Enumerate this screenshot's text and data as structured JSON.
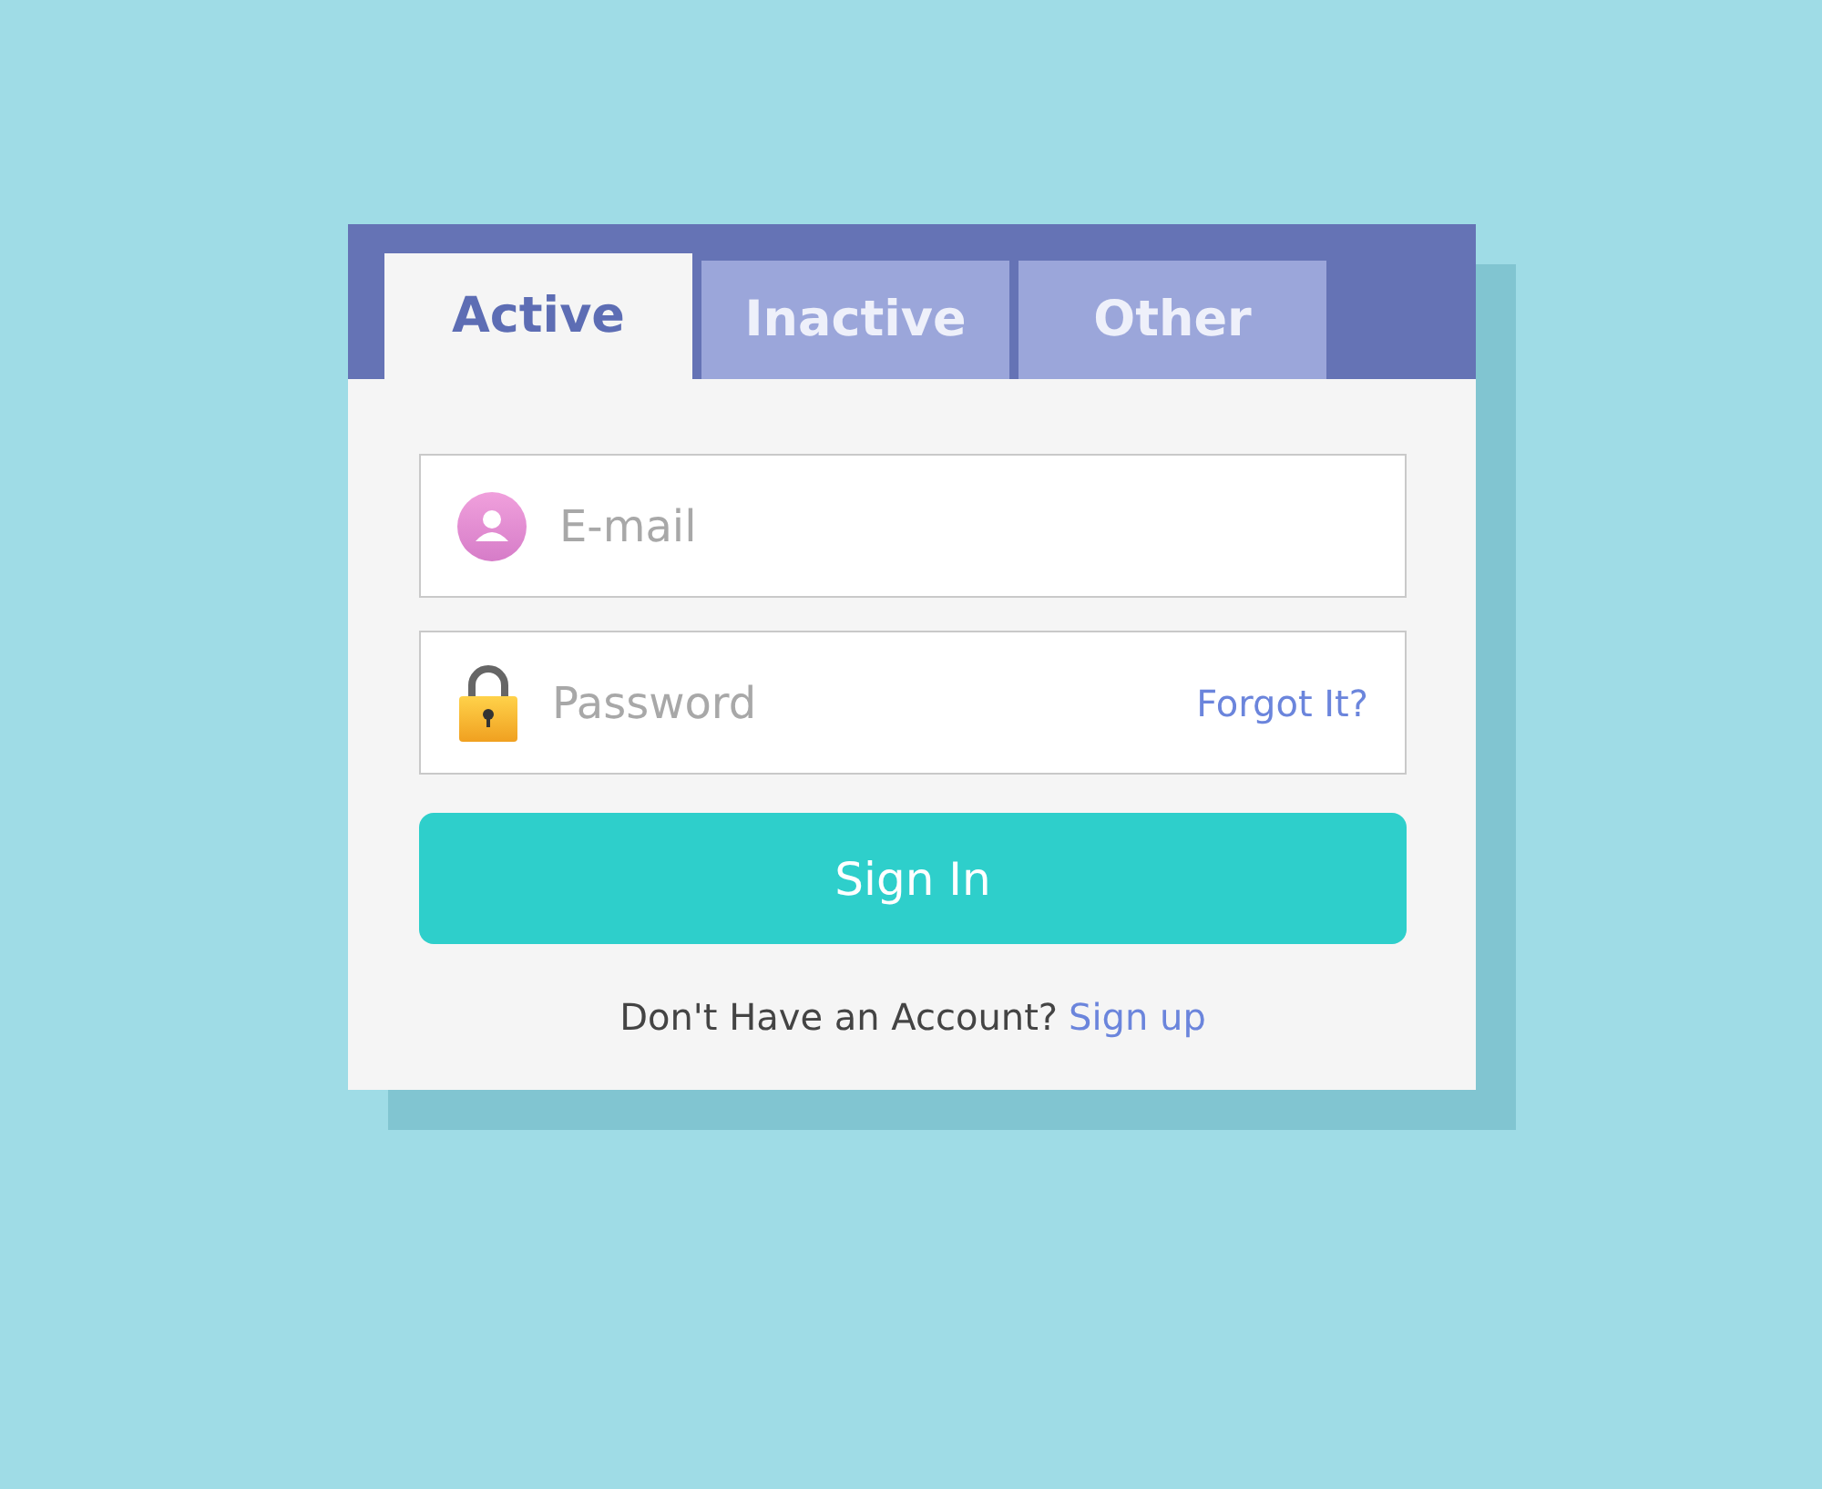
{
  "tabs": [
    {
      "label": "Active",
      "selected": true
    },
    {
      "label": "Inactive",
      "selected": false
    },
    {
      "label": "Other",
      "selected": false
    }
  ],
  "email": {
    "placeholder": "E-mail"
  },
  "password": {
    "placeholder": "Password",
    "forgot_link": "Forgot It?"
  },
  "sign_in_button": "Sign In",
  "footer": {
    "text": "Don't Have an Account?",
    "link": "Sign up"
  }
}
